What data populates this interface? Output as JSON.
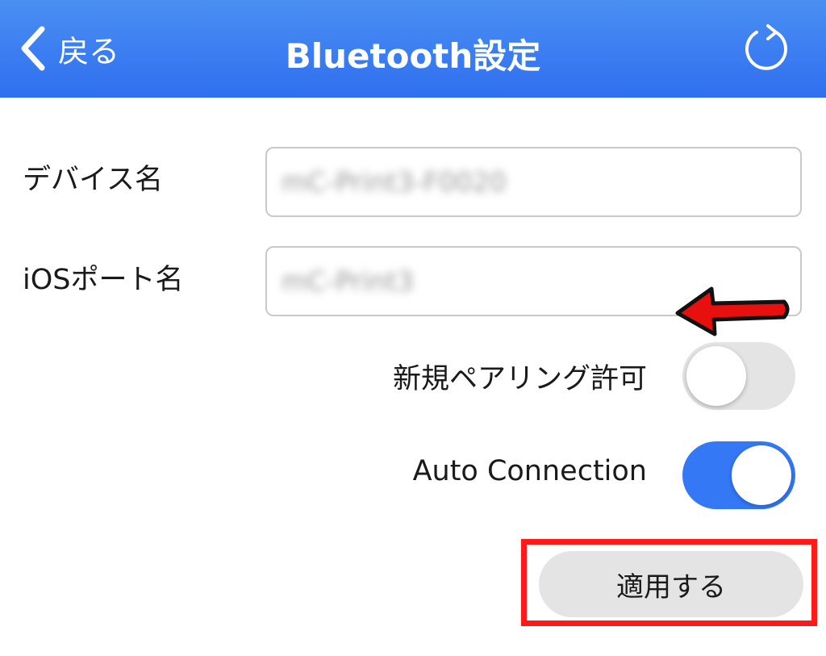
{
  "nav": {
    "back_label": "戻る",
    "title": "Bluetooth設定",
    "refresh_icon": "refresh-icon"
  },
  "form": {
    "device_name_label": "デバイス名",
    "device_name_value": "mC-Print3-F0020",
    "ios_port_label": "iOSポート名",
    "ios_port_value": "mC-Print3",
    "pairing_label": "新規ペアリング許可",
    "pairing_enabled": false,
    "auto_connection_label": "Auto Connection",
    "auto_connection_enabled": true,
    "apply_label": "適用する"
  },
  "annotations": {
    "arrow_color": "#e8100f",
    "highlight_color": "#ff1a1a"
  },
  "colors": {
    "nav_bar": "#3a7df1",
    "toggle_on": "#3478f6",
    "toggle_off": "#e4e4e4"
  }
}
